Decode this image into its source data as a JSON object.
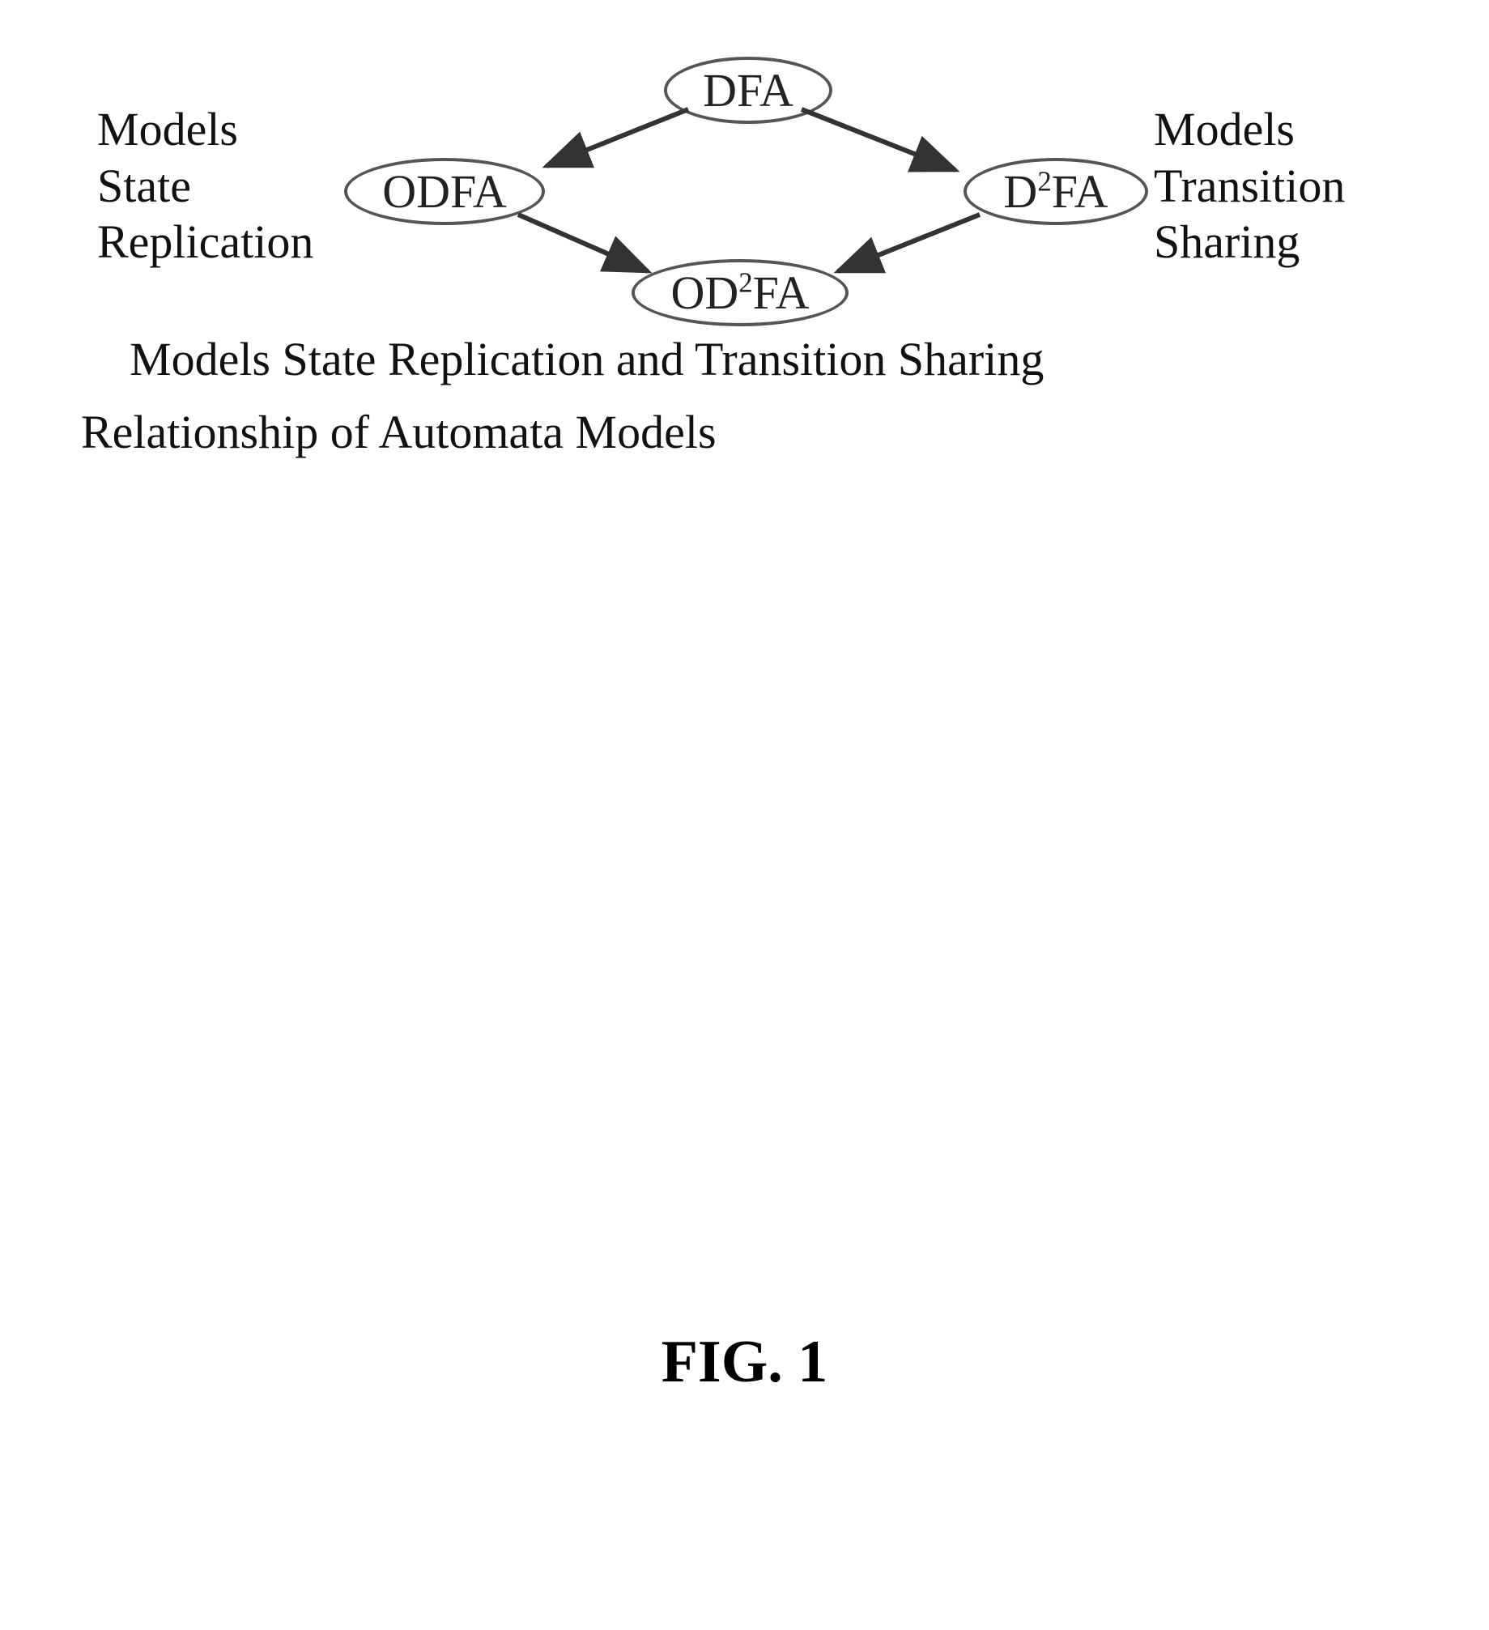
{
  "nodes": {
    "dfa": "DFA",
    "odfa": "ODFA",
    "d2fa_prefix": "D",
    "d2fa_sup": "2",
    "d2fa_suffix": "FA",
    "od2fa_prefix": "OD",
    "od2fa_sup": "2",
    "od2fa_suffix": "FA"
  },
  "labels": {
    "left_line1": "Models",
    "left_line2": "State",
    "left_line3": "Replication",
    "right_line1": "Models",
    "right_line2": "Transition",
    "right_line3": "Sharing",
    "bottom1": "Models State Replication and Transition Sharing",
    "bottom2": "Relationship of Automata Models",
    "figure": "FIG. 1"
  },
  "chart_data": {
    "type": "diagram",
    "title": "Relationship of Automata Models",
    "nodes": [
      {
        "id": "DFA",
        "label": "DFA"
      },
      {
        "id": "ODFA",
        "label": "ODFA",
        "annotation": "Models State Replication"
      },
      {
        "id": "D2FA",
        "label": "D²FA",
        "annotation": "Models Transition Sharing"
      },
      {
        "id": "OD2FA",
        "label": "OD²FA",
        "annotation": "Models State Replication and Transition Sharing"
      }
    ],
    "edges": [
      {
        "from": "DFA",
        "to": "ODFA"
      },
      {
        "from": "DFA",
        "to": "D2FA"
      },
      {
        "from": "ODFA",
        "to": "OD2FA"
      },
      {
        "from": "D2FA",
        "to": "OD2FA"
      }
    ]
  }
}
